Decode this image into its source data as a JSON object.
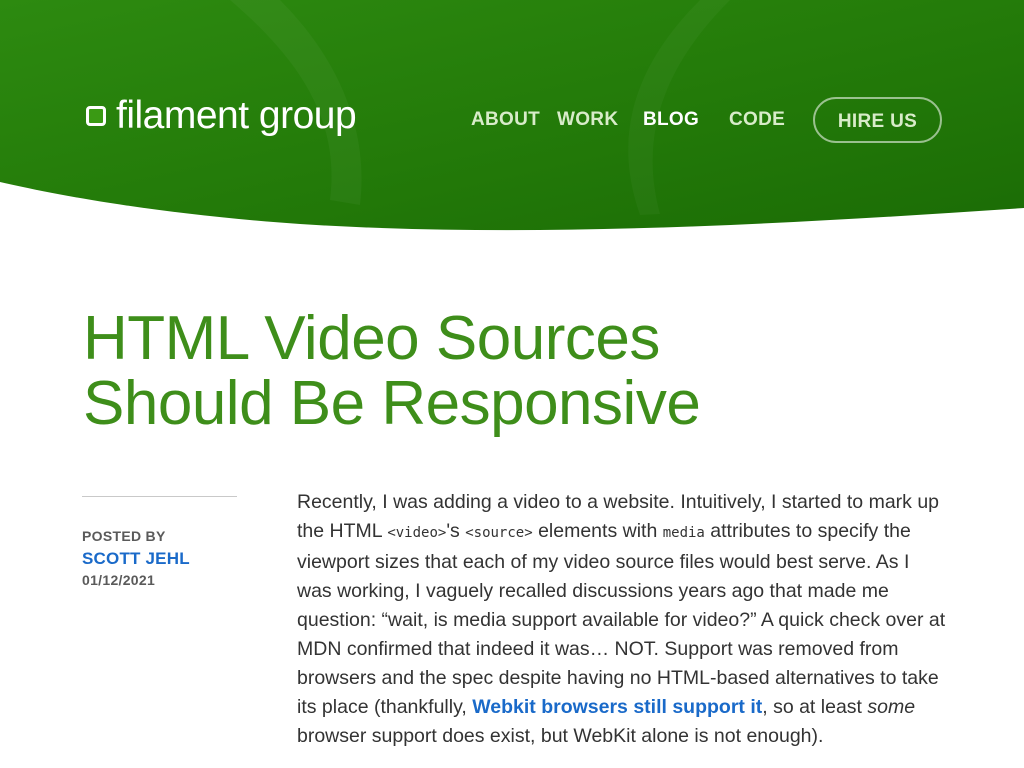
{
  "header": {
    "logo_text": "filament group",
    "colors": {
      "green_dark": "#1d6e06",
      "green_light": "#3f9b1b"
    }
  },
  "nav": {
    "items": [
      {
        "label": "ABOUT"
      },
      {
        "label": "WORK"
      },
      {
        "label": "BLOG"
      },
      {
        "label": "CODE"
      }
    ],
    "hire_label": "HIRE US"
  },
  "article": {
    "title_line1": "HTML Video Sources",
    "title_line2": "Should Be Responsive",
    "posted_by_label": "POSTED BY",
    "author": "SCOTT JEHL",
    "date": "01/12/2021",
    "p": {
      "s1": "Recently, I was adding a video to a website. Intuitively, I started to mark up the HTML ",
      "code1": "<video>",
      "s2": "'s ",
      "code2": "<source>",
      "s3": " elements with ",
      "code3": "media",
      "s4": " attributes to specify the viewport sizes that each of my video source files would best serve. As I was working, I vaguely recalled discussions years ago that made me question: “wait, is media support available for video?” A quick check over at MDN confirmed that indeed it was… NOT. Support was removed from browsers and the spec despite having no HTML-based alternatives to take its place (thankfully, ",
      "link": "Webkit browsers still support it",
      "s5": ", so at least ",
      "em": "some",
      "s6": " browser support does exist, but WebKit alone is not enough)."
    }
  }
}
